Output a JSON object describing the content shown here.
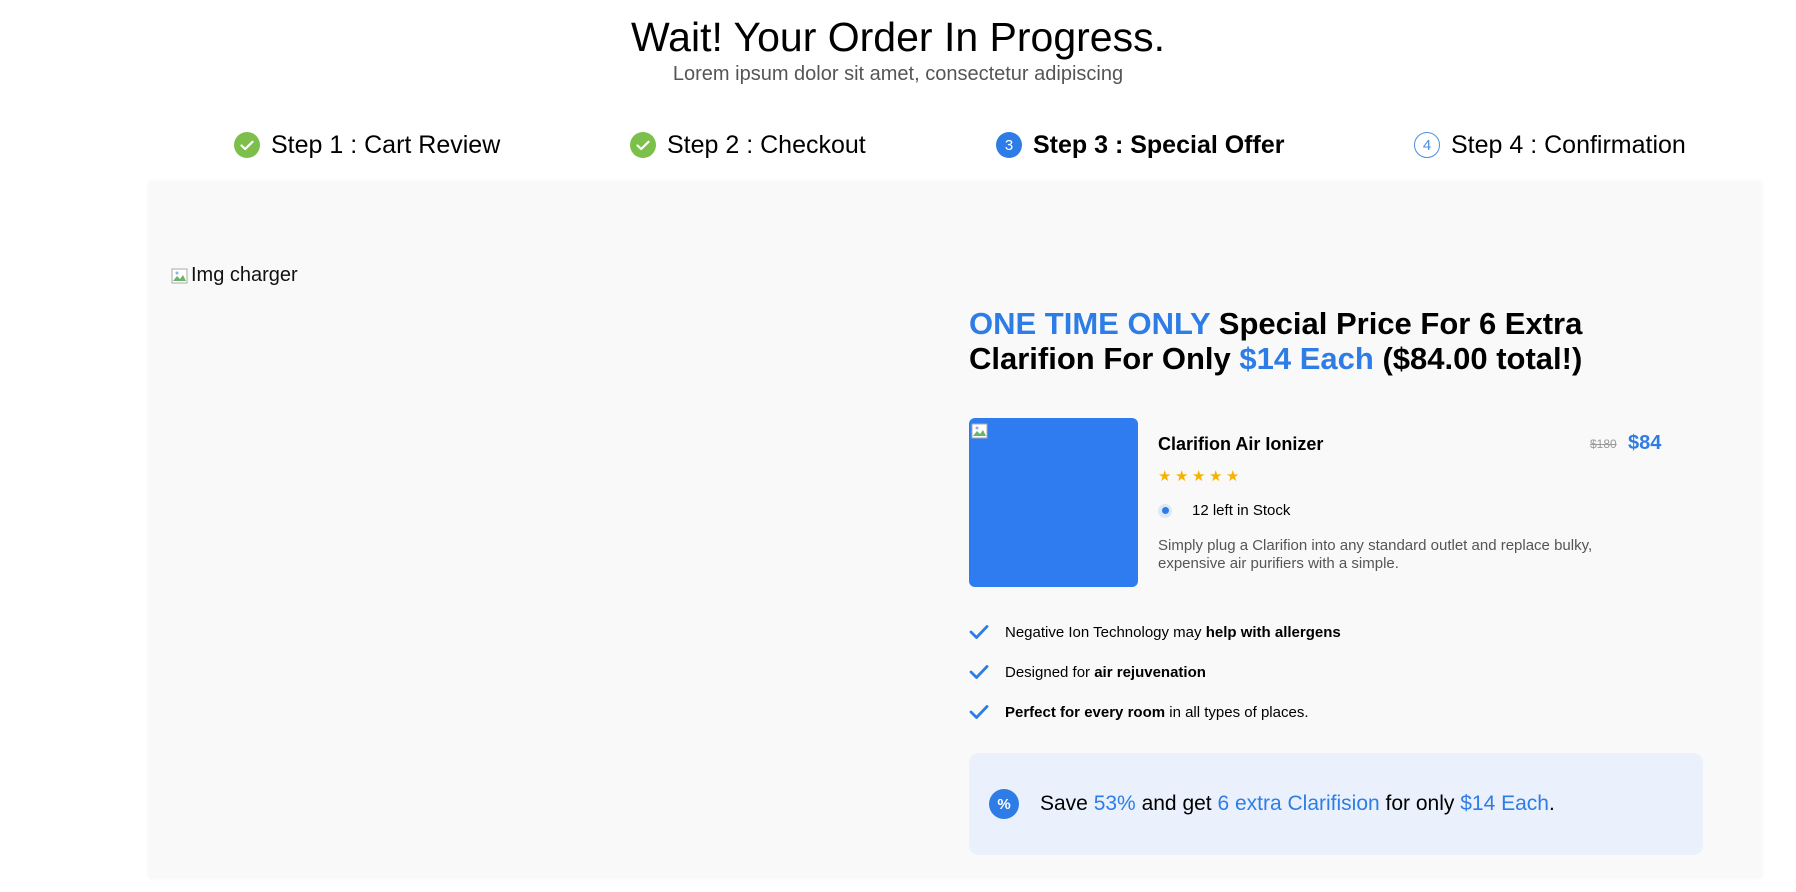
{
  "header": {
    "title": "Wait! Your Order In Progress.",
    "subtitle": "Lorem ipsum dolor sit amet, consectetur adipiscing"
  },
  "steps": [
    {
      "label": "Step 1 : Cart Review",
      "status": "done",
      "icon": "check-circle-icon"
    },
    {
      "label": "Step 2 : Checkout",
      "status": "done",
      "icon": "check-circle-icon"
    },
    {
      "label": "Step 3 : Special Offer",
      "status": "current",
      "number": "3",
      "icon": "number-circle-icon"
    },
    {
      "label": "Step 4 : Confirmation",
      "status": "upcoming",
      "number": "4",
      "icon": "number-circle-outline-icon"
    }
  ],
  "hero_image": {
    "alt": "Img charger"
  },
  "offer": {
    "headline_highlight": "ONE TIME ONLY",
    "headline_part1": " Special Price For 6 Extra Clarifion For Only ",
    "headline_price": "$14 Each",
    "headline_part2": " ($84.00 total!)"
  },
  "product": {
    "name": "Clarifion Air Ionizer",
    "old_price": "$180",
    "new_price": "$84",
    "rating": 5,
    "stock_text": "12 left in Stock",
    "description": "Simply plug a Clarifion into any standard outlet and replace bulky, expensive air purifiers with a simple."
  },
  "features": [
    {
      "pre": "Negative Ion Technology may ",
      "bold": "help with allergens",
      "post": ""
    },
    {
      "pre": "Designed for ",
      "bold": "air rejuvenation",
      "post": ""
    },
    {
      "pre": "",
      "bold": "Perfect for every room",
      "post": " in all types of places."
    }
  ],
  "save": {
    "icon": "%",
    "t1": "Save ",
    "pct": "53%",
    "t2": " and get ",
    "qty": "6 extra Clarifision",
    "t3": " for only ",
    "price": "$14 Each",
    "t4": "."
  },
  "colors": {
    "accent": "#2e7de6",
    "done": "#7cc04b",
    "panel": "#f9f9f9",
    "save_bg": "#eaf1fd",
    "star": "#f5b301"
  }
}
